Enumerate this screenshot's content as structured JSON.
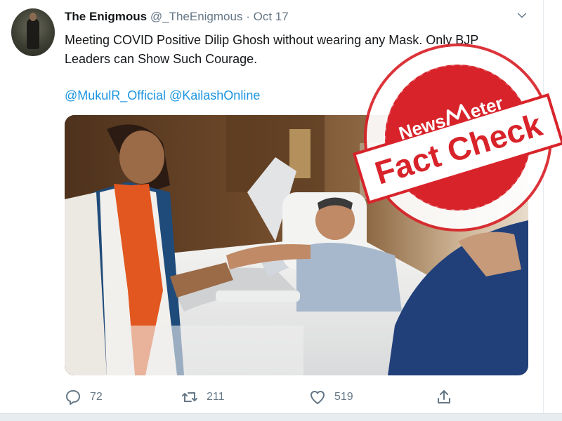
{
  "tweet": {
    "author_name": "The Enigmous",
    "handle": "@_TheEnigmous",
    "separator": "·",
    "date": "Oct 17",
    "text": "Meeting COVID Positive Dilip Ghosh without wearing any Mask. Only BJP Leaders can Show Such Courage.",
    "mentions": [
      "@MukulR_Official",
      "@KailashOnline"
    ]
  },
  "stamp": {
    "brand_prefix": "News",
    "brand_suffix": "eter",
    "title": "Fact Check",
    "color": "#d8232a"
  },
  "actions": {
    "reply_count": "72",
    "retweet_count": "211",
    "like_count": "519"
  },
  "colors": {
    "link": "#1b95e0",
    "muted": "#657786",
    "stamp_red": "#d8232a"
  }
}
